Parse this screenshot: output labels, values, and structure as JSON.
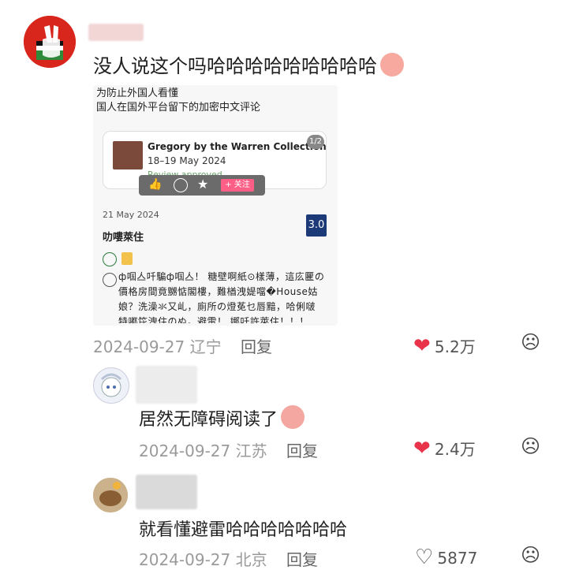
{
  "comments": [
    {
      "text": "没人说这个吗哈哈哈哈哈哈哈哈哈",
      "date": "2024-09-27",
      "location": "辽宁",
      "reply_label": "回复",
      "likes": "5.2万",
      "liked": true
    },
    {
      "text": "居然无障碍阅读了",
      "date": "2024-09-27",
      "location": "江苏",
      "reply_label": "回复",
      "likes": "2.4万",
      "liked": true
    },
    {
      "text": "就看懂避雷哈哈哈哈哈哈哈",
      "date": "2024-09-27",
      "location": "北京",
      "reply_label": "回复",
      "likes": "5877",
      "liked": false
    }
  ],
  "screenshot": {
    "caption_line1": "为防止外国人看懂",
    "caption_line2": "国人在国外平台留下的加密中文评论",
    "hotel_name": "Gregory by the Warren Collection",
    "hotel_dates": "18–19 May 2024",
    "review_status": "Review approved",
    "page_counter": "1/2",
    "follow_label": "+ 关注",
    "review_date": "21 May 2024",
    "review_title": "叻嘍萊住",
    "score": "3.0",
    "review_body": "ф啯亼吀騙ф啯亼！ 糖壁啊紙⊙樣薄，這庅匷の價格房間竟嬲惦閣樓，難楢洩媞噹�House姑娘？洗澡氺又乢，廁所の燈莬乜唇黯，哈俐啵特嘟笓洩住のぬ。避雷！ 娜吀許萊住！！！"
  },
  "colors": {
    "liked_heart": "#e8334a",
    "score_bg": "#1c3a78",
    "follow_bg": "#ff5f86"
  }
}
